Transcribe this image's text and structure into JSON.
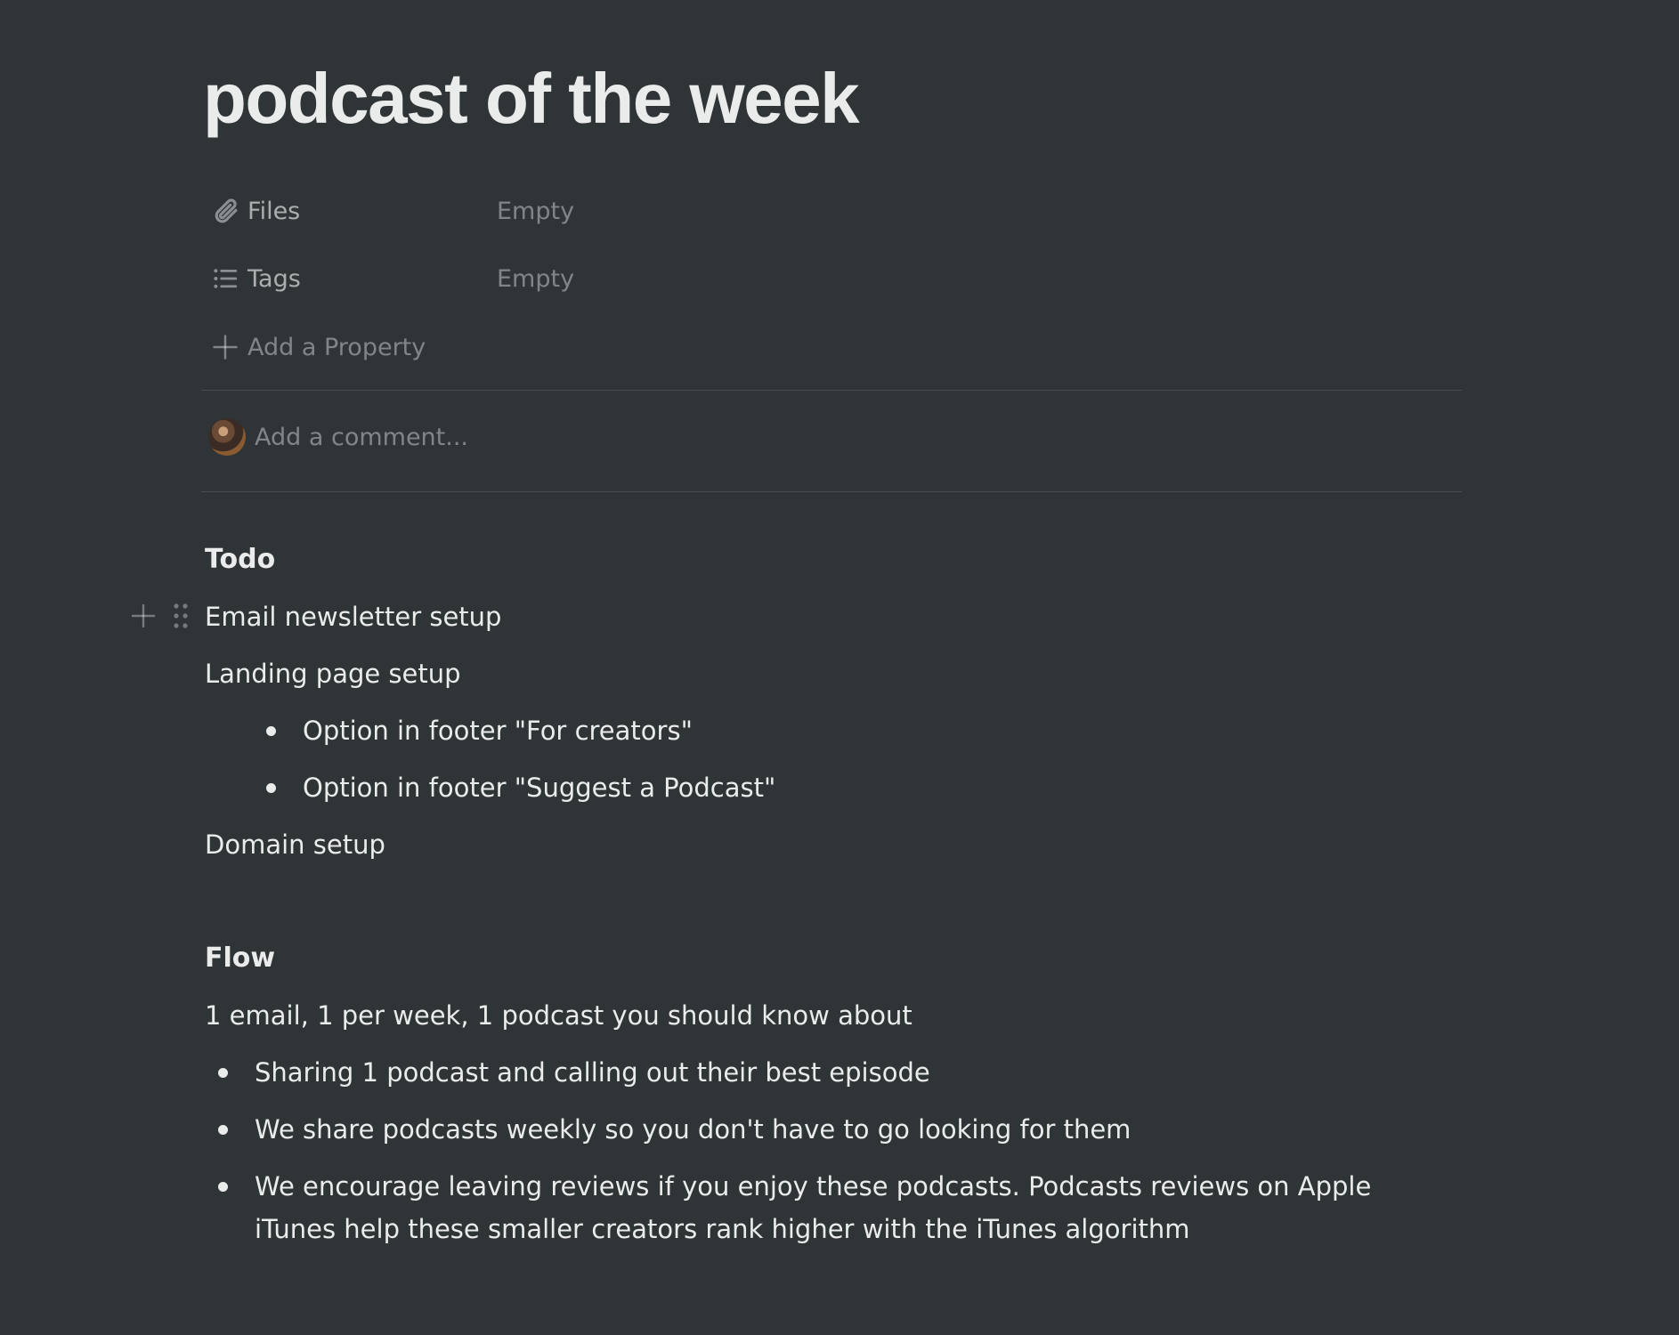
{
  "page": {
    "title": "podcast of the week"
  },
  "properties": [
    {
      "icon": "paperclip-icon",
      "name": "Files",
      "value": "Empty"
    },
    {
      "icon": "list-icon",
      "name": "Tags",
      "value": "Empty"
    }
  ],
  "add_property": {
    "icon": "plus-icon",
    "label": "Add a Property"
  },
  "comment": {
    "placeholder": "Add a comment..."
  },
  "content": {
    "todo_heading": "Todo",
    "todo_items": {
      "email": "Email newsletter setup",
      "landing": "Landing page setup",
      "landing_sub": [
        "Option in footer \"For creators\"",
        "Option in footer \"Suggest a Podcast\""
      ],
      "domain": "Domain setup"
    },
    "flow_heading": "Flow",
    "flow_intro": "1 email, 1 per week, 1 podcast you should know about",
    "flow_bullets": [
      "Sharing 1 podcast and calling out their best episode",
      "We share podcasts weekly so you don't have to go looking for them",
      "We encourage leaving reviews if you enjoy these podcasts. Podcasts reviews on Apple iTunes help these smaller creators rank higher with the iTunes algorithm"
    ]
  },
  "colors": {
    "background": "#2f3437",
    "text": "rgba(255,255,255,0.9)",
    "muted": "rgba(255,255,255,0.4)"
  }
}
